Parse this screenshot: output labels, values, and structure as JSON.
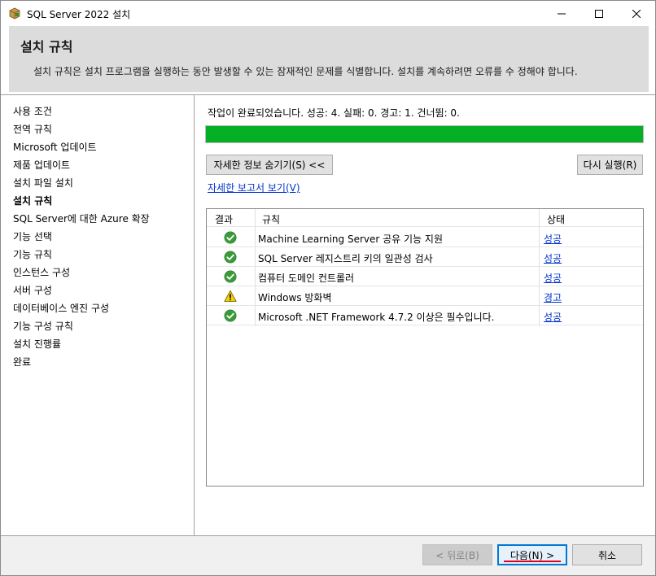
{
  "window": {
    "title": "SQL Server 2022 설치",
    "icons": {
      "app": "sql-setup-box-icon",
      "minimize": "minimize-icon",
      "maximize": "maximize-icon",
      "close": "close-icon"
    }
  },
  "header": {
    "title": "설치 규칙",
    "description": "설치 규칙은 설치 프로그램을 실행하는 동안 발생할 수 있는 잠재적인 문제를 식별합니다. 설치를 계속하려면 오류를 수 정해야 합니다."
  },
  "nav": {
    "items": [
      {
        "label": "사용 조건",
        "active": false
      },
      {
        "label": "전역 규칙",
        "active": false
      },
      {
        "label": "Microsoft 업데이트",
        "active": false
      },
      {
        "label": "제품 업데이트",
        "active": false
      },
      {
        "label": "설치 파일 설치",
        "active": false
      },
      {
        "label": "설치 규칙",
        "active": true
      },
      {
        "label": "SQL Server에 대한 Azure 확장",
        "active": false
      },
      {
        "label": "기능 선택",
        "active": false
      },
      {
        "label": "기능 규칙",
        "active": false
      },
      {
        "label": "인스턴스 구성",
        "active": false
      },
      {
        "label": "서버 구성",
        "active": false
      },
      {
        "label": "데이터베이스 엔진 구성",
        "active": false
      },
      {
        "label": "기능 구성 규칙",
        "active": false
      },
      {
        "label": "설치 진행률",
        "active": false
      },
      {
        "label": "완료",
        "active": false
      }
    ]
  },
  "main": {
    "status_text": "작업이 완료되었습니다. 성공: 4. 실패: 0. 경고: 1. 건너뜀: 0.",
    "progress": 1.0,
    "progress_color": "#06b025",
    "hide_details_label": "자세한 정보 숨기기(S) <<",
    "rerun_label": "다시 실행(R)",
    "report_link": "자세한 보고서 보기(V)",
    "table": {
      "headers": {
        "result": "결과",
        "rule": "규칙",
        "status": "상태"
      },
      "rows": [
        {
          "icon": "success-check-icon",
          "rule": "Machine Learning Server 공유 기능 지원",
          "status": "성공"
        },
        {
          "icon": "success-check-icon",
          "rule": "SQL Server 레지스트리 키의 일관성 검사",
          "status": "성공"
        },
        {
          "icon": "success-check-icon",
          "rule": "컴퓨터 도메인 컨트롤러",
          "status": "성공"
        },
        {
          "icon": "warning-icon",
          "rule": "Windows 방화벽",
          "status": "경고"
        },
        {
          "icon": "success-check-icon",
          "rule": "Microsoft .NET Framework 4.7.2 이상은 필수입니다.",
          "status": "성공"
        }
      ]
    }
  },
  "footer": {
    "back_label": "< 뒤로(B)",
    "next_label": "다음(N) >",
    "cancel_label": "취소"
  }
}
